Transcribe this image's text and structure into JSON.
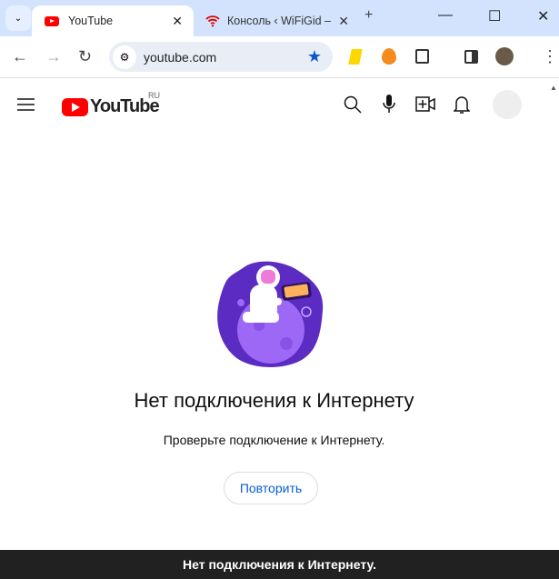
{
  "browser": {
    "tabs": [
      {
        "title": "YouTube",
        "icon": "youtube-favicon"
      },
      {
        "title": "Консоль ‹ WiFiGid –",
        "icon": "wifi-icon"
      }
    ],
    "url": "youtube.com",
    "glyphs": {
      "dropdown": "⌄",
      "close": "✕",
      "new_tab": "+",
      "minimize": "—",
      "maximize": "☐",
      "back": "←",
      "forward": "→",
      "reload": "↻",
      "star": "★",
      "menu": "⋮",
      "tune": "⚙"
    }
  },
  "youtube": {
    "logo_text": "YouTube",
    "region": "RU"
  },
  "offline": {
    "title": "Нет подключения к Интернету",
    "message": "Проверьте подключение к Интернету.",
    "retry_label": "Повторить"
  },
  "snackbar": "Нет подключения к Интернету.",
  "colors": {
    "brand": "#ff0000",
    "link": "#065fd4",
    "illustration": "#7b3fe4"
  }
}
